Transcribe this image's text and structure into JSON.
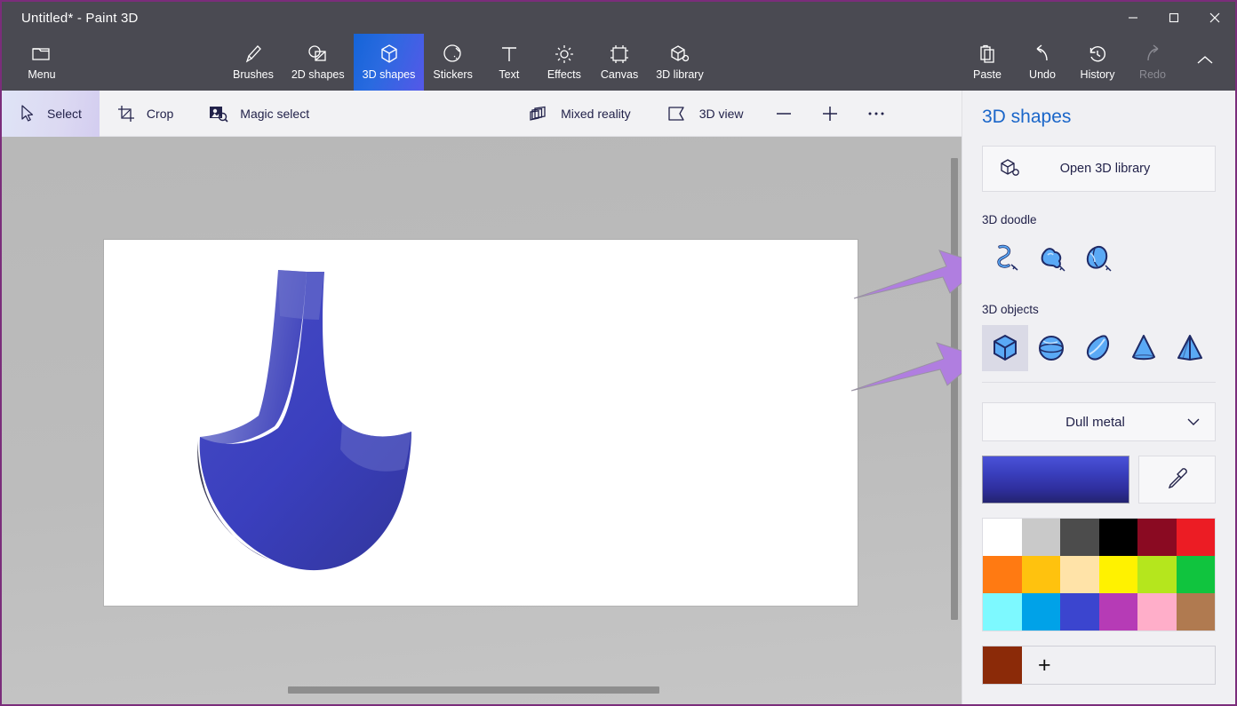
{
  "window": {
    "title": "Untitled* - Paint 3D",
    "controls": [
      {
        "name": "minimize",
        "glyph": "—"
      },
      {
        "name": "maximize",
        "glyph": "□"
      },
      {
        "name": "close",
        "glyph": "✕"
      }
    ]
  },
  "ribbon": {
    "menu_label": "Menu",
    "tabs": [
      {
        "label": "Brushes",
        "icon": "brush-icon",
        "active": false,
        "disabled": false
      },
      {
        "label": "2D shapes",
        "icon": "2d-shapes-icon",
        "active": false,
        "disabled": false
      },
      {
        "label": "3D shapes",
        "icon": "3d-shapes-icon",
        "active": true,
        "disabled": false
      },
      {
        "label": "Stickers",
        "icon": "stickers-icon",
        "active": false,
        "disabled": false
      },
      {
        "label": "Text",
        "icon": "text-icon",
        "active": false,
        "disabled": false
      },
      {
        "label": "Effects",
        "icon": "effects-icon",
        "active": false,
        "disabled": false
      },
      {
        "label": "Canvas",
        "icon": "canvas-icon",
        "active": false,
        "disabled": false
      },
      {
        "label": "3D library",
        "icon": "3d-library-icon",
        "active": false,
        "disabled": false
      }
    ],
    "actions": [
      {
        "label": "Paste",
        "icon": "paste-icon",
        "disabled": false
      },
      {
        "label": "Undo",
        "icon": "undo-icon",
        "disabled": false
      },
      {
        "label": "History",
        "icon": "history-icon",
        "disabled": false
      },
      {
        "label": "Redo",
        "icon": "redo-icon",
        "disabled": true
      }
    ],
    "collapse_icon": "chevron-up-icon"
  },
  "subbar": {
    "left_tools": [
      {
        "label": "Select",
        "icon": "cursor-arrow-icon",
        "selected": true
      },
      {
        "label": "Crop",
        "icon": "crop-icon",
        "selected": false
      },
      {
        "label": "Magic select",
        "icon": "magic-select-icon",
        "selected": false
      }
    ],
    "center_tools": [
      {
        "label": "Mixed reality",
        "icon": "mixed-reality-icon"
      },
      {
        "label": "3D view",
        "icon": "3d-view-icon"
      }
    ],
    "zoom_out_icon": "minus-icon",
    "zoom_in_icon": "plus-icon",
    "more_icon": "ellipsis-icon"
  },
  "canvas": {
    "artwork_name": "blue-3d-doodle-shape",
    "artwork_color": "#3a3fbe",
    "vertical_scrollbar": "canvas-vertical-scrollbar",
    "horizontal_scrollbar": "canvas-horizontal-scrollbar"
  },
  "annotations": [
    {
      "name": "arrow-to-3d-doodle",
      "color": "#b07ee0"
    },
    {
      "name": "arrow-to-3d-objects",
      "color": "#b07ee0"
    }
  ],
  "panel": {
    "title": "3D shapes",
    "accent_color": "#1a66c9",
    "open_library_label": "Open 3D library",
    "open_library_icon": "3d-library-icon",
    "doodle_section_label": "3D doodle",
    "doodle_shapes": [
      {
        "name": "soft-edge-doodle-icon"
      },
      {
        "name": "sharp-edge-doodle-icon"
      },
      {
        "name": "tube-doodle-icon"
      }
    ],
    "objects_section_label": "3D objects",
    "object_shapes": [
      {
        "name": "cube-icon",
        "selected": true
      },
      {
        "name": "sphere-icon",
        "selected": false
      },
      {
        "name": "teardrop-icon",
        "selected": false
      },
      {
        "name": "cone-icon",
        "selected": false
      },
      {
        "name": "pyramid-icon",
        "selected": false
      }
    ],
    "material_label": "Dull metal",
    "material_chevron": "chevron-down-icon",
    "current_color": "#3a3fbe",
    "eyedropper_icon": "eyedropper-icon",
    "palette": [
      [
        "#ffffff",
        "#c9c9c9",
        "#4c4c4c",
        "#000000",
        "#8a0a22",
        "#ec1c24"
      ],
      [
        "#ff7a12",
        "#ffc20e",
        "#ffe3a8",
        "#fff200",
        "#b5e61d",
        "#10c43e"
      ],
      [
        "#7df9ff",
        "#00a2e8",
        "#3b45cf",
        "#b63bb6",
        "#ffaec9",
        "#b07a50"
      ]
    ],
    "custom_color": "#8b2a08",
    "add_color_label": "+"
  }
}
